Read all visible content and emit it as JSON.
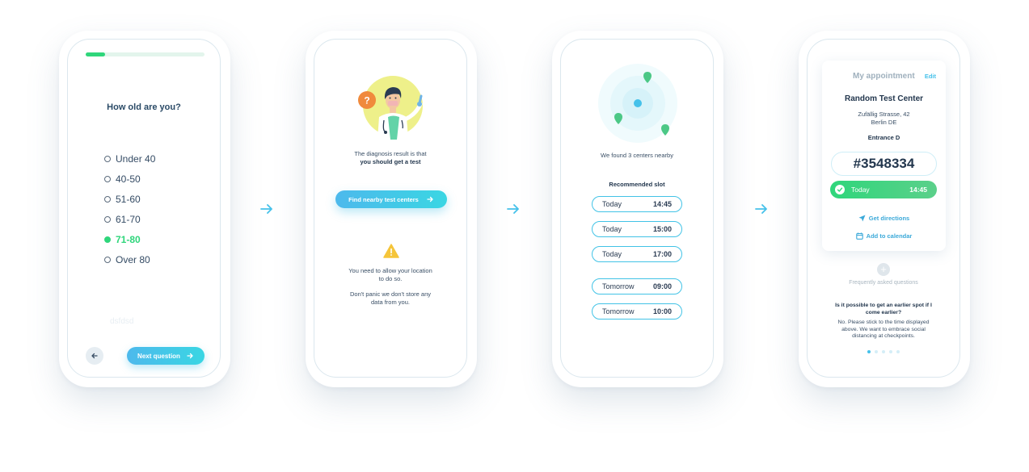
{
  "colors": {
    "accent": "#45c1ea",
    "green": "#2fd67b",
    "text_dark": "#22364d",
    "bg": "#ffffff"
  },
  "screen1": {
    "progress_fraction": 0.16,
    "question": "How old are you?",
    "options": [
      {
        "label": "Under 40",
        "selected": false
      },
      {
        "label": "40-50",
        "selected": false
      },
      {
        "label": "51-60",
        "selected": false
      },
      {
        "label": "61-70",
        "selected": false
      },
      {
        "label": "71-80",
        "selected": true
      },
      {
        "label": "Over 80",
        "selected": false
      }
    ],
    "ghost_text": "dsfdsd",
    "back_icon": "arrow-left-icon",
    "next_label": "Next question"
  },
  "screen2": {
    "illustration": "doctor-illustration",
    "diagnosis_line1": "The diagnosis result is that",
    "diagnosis_line2": "you should get a test",
    "find_label": "Find nearby test centers",
    "warning_icon": "warning-icon",
    "location_note_line1": "You need to allow your location",
    "location_note_line2": "to do so.",
    "privacy_note_line1": "Don't panic we don't store any",
    "privacy_note_line2": "data from you."
  },
  "screen3": {
    "map_icon": "radar-map-icon",
    "found_text": "We found 3 centers nearby",
    "recommended_title": "Recommended slot",
    "slots": [
      {
        "day": "Today",
        "time": "14:45"
      },
      {
        "day": "Today",
        "time": "15:00"
      },
      {
        "day": "Today",
        "time": "17:00"
      },
      {
        "day": "Tomorrow",
        "time": "09:00"
      },
      {
        "day": "Tomorrow",
        "time": "10:00"
      }
    ]
  },
  "screen4": {
    "card_title": "My appointment",
    "edit_label": "Edit",
    "center_name": "Random Test Center",
    "address_line1": "Zufällig Strasse, 42",
    "address_line2": "Berlin DE",
    "entrance": "Entrance D",
    "code": "#3548334",
    "slot_day": "Today",
    "slot_time": "14:45",
    "directions_label": "Get directions",
    "calendar_label": "Add to calendar",
    "faq_label": "Frequently asked questions",
    "faq_question_line1": "Is it possible to get an earlier spot if I",
    "faq_question_line2": "come earlier?",
    "faq_answer_line1": "No. Please stick to the time displayed",
    "faq_answer_line2": "above. We want to embrace social",
    "faq_answer_line3": "distancing at checkpoints.",
    "page_count": 5,
    "active_page": 1
  }
}
